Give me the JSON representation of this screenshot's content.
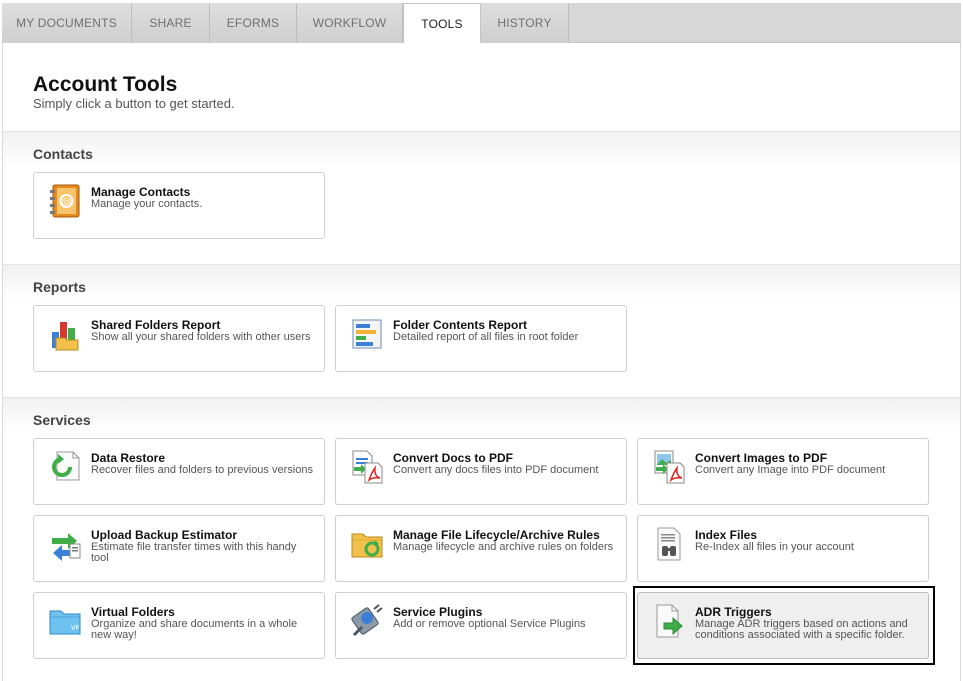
{
  "tabs": [
    {
      "label": "MY DOCUMENTS"
    },
    {
      "label": "SHARE"
    },
    {
      "label": "EFORMS"
    },
    {
      "label": "WORKFLOW"
    },
    {
      "label": "TOOLS"
    },
    {
      "label": "HISTORY"
    }
  ],
  "header": {
    "title": "Account Tools",
    "subtitle": "Simply click a button to get started."
  },
  "sections": {
    "contacts": {
      "title": "Contacts",
      "cards": [
        {
          "title": "Manage Contacts",
          "desc": "Manage your contacts.",
          "icon": "address-book-icon"
        }
      ]
    },
    "reports": {
      "title": "Reports",
      "cards": [
        {
          "title": "Shared Folders Report",
          "desc": "Show all your shared folders with other users",
          "icon": "bar-chart-folder-icon"
        },
        {
          "title": "Folder Contents Report",
          "desc": "Detailed report of all files in root folder",
          "icon": "report-list-icon"
        }
      ]
    },
    "services": {
      "title": "Services",
      "cards": [
        {
          "title": "Data Restore",
          "desc": "Recover files and folders to previous versions",
          "icon": "restore-icon"
        },
        {
          "title": "Convert Docs to PDF",
          "desc": "Convert any docs files into PDF document",
          "icon": "doc-to-pdf-icon"
        },
        {
          "title": "Convert Images to PDF",
          "desc": "Convert any Image into PDF document",
          "icon": "image-to-pdf-icon"
        },
        {
          "title": "Upload Backup Estimator",
          "desc": "Estimate file transfer times with this handy tool",
          "icon": "transfer-arrows-icon"
        },
        {
          "title": "Manage File Lifecycle/Archive Rules",
          "desc": "Manage lifecycle and archive rules on folders",
          "icon": "folder-cycle-icon"
        },
        {
          "title": "Index Files",
          "desc": "Re-Index all files in your account",
          "icon": "index-files-icon"
        },
        {
          "title": "Virtual Folders",
          "desc": "Organize and share documents in a whole new way!",
          "icon": "virtual-folder-icon"
        },
        {
          "title": "Service Plugins",
          "desc": "Add or remove optional Service Plugins",
          "icon": "plugin-icon"
        },
        {
          "title": "ADR Triggers",
          "desc": "Manage ADR triggers based on actions and conditions associated with a specific folder.",
          "icon": "adr-trigger-icon"
        }
      ]
    }
  },
  "colors": {
    "active_tab_bg": "#ffffff",
    "tab_bg": "#d7d7d7",
    "selected_card_bg": "#efefef",
    "selected_outline": "#000000"
  }
}
